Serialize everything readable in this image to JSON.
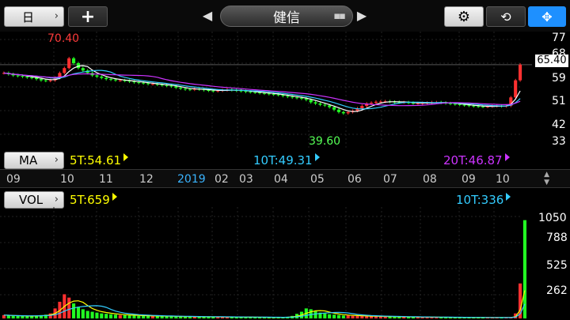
{
  "toolbar": {
    "period_label": "日",
    "add_label": "+",
    "stock_name": "健信"
  },
  "price_axis": [
    "77",
    "68",
    "59",
    "51",
    "42",
    "33"
  ],
  "last_price": "65.40",
  "high_label": "70.40",
  "low_label": "39.60",
  "ma_row": {
    "button": "MA",
    "ma5": "5T:54.61",
    "ma10": "10T:49.31",
    "ma20": "20T:46.87"
  },
  "date_axis": [
    "09",
    "10",
    "11",
    "12",
    "2019",
    "02",
    "03",
    "04",
    "05",
    "06",
    "07",
    "08",
    "09",
    "10"
  ],
  "vol_row": {
    "button": "VOL",
    "vol5": "5T:659",
    "vol10": "10T:336"
  },
  "volume_axis": [
    "1050",
    "788",
    "525",
    "262"
  ],
  "colors": {
    "up": "#ff3030",
    "down": "#22ff22",
    "ma5": "#ffffff",
    "ma10": "#33ccff",
    "ma20": "#cc33ff",
    "vol5": "#ffff00",
    "accent": "#1e90ff"
  },
  "chart_data": {
    "type": "candlestick",
    "price_range": [
      33,
      77
    ],
    "closes": [
      62,
      61.5,
      61,
      60.8,
      60.5,
      60.2,
      60,
      59.5,
      59,
      58.8,
      59,
      60,
      62,
      64,
      68,
      66,
      64,
      63,
      62,
      61,
      60.5,
      60,
      59.5,
      59.3,
      59,
      59,
      58.8,
      58.5,
      58.2,
      58,
      57.8,
      57.5,
      57.5,
      57.2,
      57,
      56.8,
      56.5,
      56,
      55.6,
      55.3,
      55.2,
      55.5,
      55.3,
      55,
      54.8,
      54.6,
      54.8,
      55,
      55.2,
      55,
      54.8,
      54.6,
      54.3,
      54.2,
      54,
      53.8,
      53.6,
      53.4,
      53.2,
      53,
      52.6,
      52.3,
      52,
      51.8,
      51.5,
      51,
      50,
      49.5,
      49,
      48.7,
      48,
      47,
      46,
      45.5,
      46,
      46.5,
      47.5,
      48.5,
      49.5,
      49.8,
      50.2,
      50.3,
      50.4,
      50.2,
      50.1,
      50,
      50,
      49.8,
      49.6,
      49.6,
      49.7,
      49.8,
      50,
      50,
      49.8,
      49.6,
      49.4,
      49.2,
      49,
      48.8,
      48.6,
      48.4,
      48.3,
      48.2,
      48.3,
      48.5,
      48.6,
      48.4,
      48.6,
      52,
      59,
      65.4
    ],
    "volumes": [
      40,
      35,
      30,
      28,
      30,
      25,
      30,
      35,
      40,
      45,
      60,
      120,
      200,
      290,
      250,
      180,
      140,
      110,
      90,
      80,
      70,
      60,
      55,
      50,
      45,
      40,
      40,
      35,
      35,
      30,
      30,
      30,
      28,
      28,
      25,
      25,
      25,
      22,
      22,
      20,
      20,
      22,
      20,
      18,
      18,
      18,
      20,
      18,
      18,
      16,
      16,
      15,
      15,
      14,
      14,
      14,
      13,
      13,
      12,
      12,
      15,
      20,
      30,
      55,
      80,
      120,
      110,
      90,
      70,
      60,
      50,
      45,
      40,
      35,
      35,
      30,
      30,
      28,
      25,
      25,
      25,
      22,
      22,
      20,
      20,
      18,
      18,
      18,
      16,
      16,
      15,
      15,
      14,
      14,
      14,
      13,
      13,
      12,
      12,
      12,
      12,
      11,
      11,
      11,
      10,
      10,
      10,
      10,
      10,
      12,
      60,
      420,
      1180
    ],
    "volume_range": [
      0,
      1300
    ]
  }
}
